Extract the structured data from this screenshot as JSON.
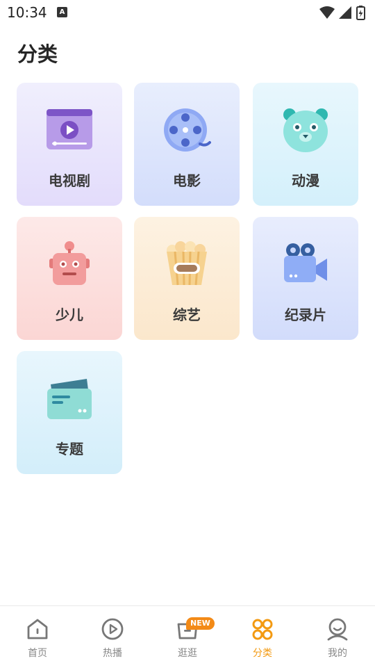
{
  "status_bar": {
    "time": "10:34",
    "notification_letter": "A"
  },
  "page": {
    "title": "分类"
  },
  "categories": [
    {
      "label": "电视剧",
      "icon": "tv-play-icon"
    },
    {
      "label": "电影",
      "icon": "film-reel-icon"
    },
    {
      "label": "动漫",
      "icon": "cartoon-bear-icon"
    },
    {
      "label": "少儿",
      "icon": "robot-icon"
    },
    {
      "label": "综艺",
      "icon": "popcorn-icon"
    },
    {
      "label": "纪录片",
      "icon": "video-camera-icon"
    },
    {
      "label": "专题",
      "icon": "card-folder-icon"
    }
  ],
  "bottom_nav": {
    "items": [
      {
        "label": "首页",
        "icon": "home-icon"
      },
      {
        "label": "热播",
        "icon": "play-circle-icon"
      },
      {
        "label": "逛逛",
        "icon": "bag-icon",
        "badge": "NEW"
      },
      {
        "label": "分类",
        "icon": "category-grid-icon",
        "active": true
      },
      {
        "label": "我的",
        "icon": "user-icon"
      }
    ]
  },
  "colors": {
    "accent": "#f39a12",
    "badge": "#f38a17",
    "inactive": "#888888"
  }
}
